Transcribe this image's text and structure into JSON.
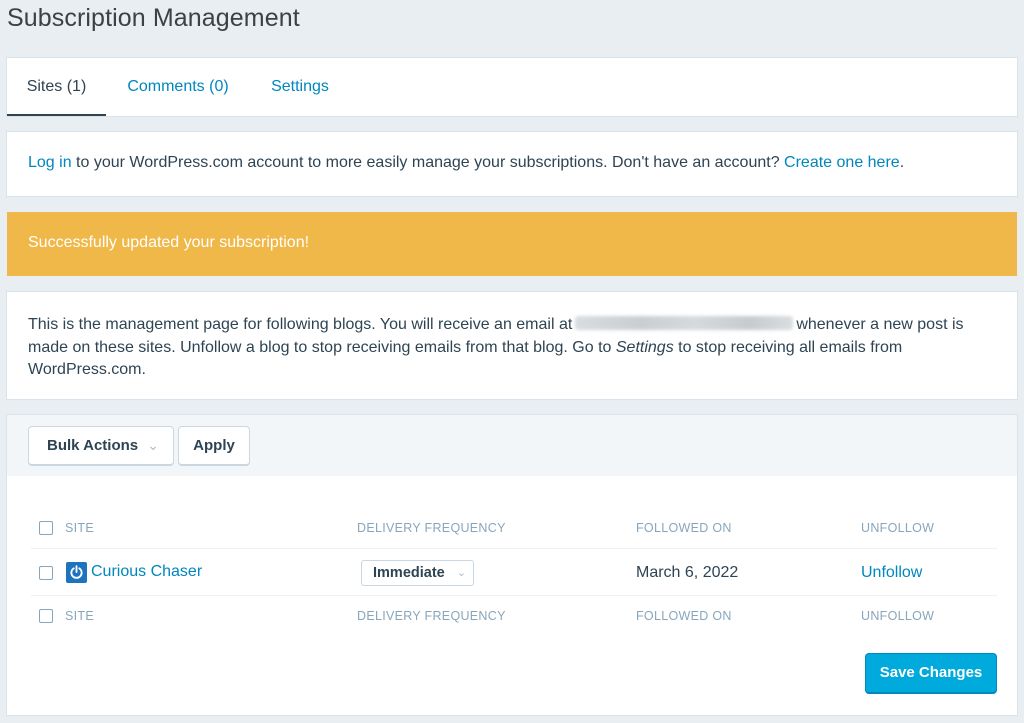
{
  "page": {
    "title": "Subscription Management"
  },
  "tabs": [
    {
      "label": "Sites (1)",
      "active": true
    },
    {
      "label": "Comments (0)",
      "active": false
    },
    {
      "label": "Settings",
      "active": false
    }
  ],
  "login_notice": {
    "login_link": "Log in",
    "text_middle": " to your WordPress.com account to more easily manage your subscriptions. Don't have an account? ",
    "create_link": "Create one here",
    "text_end": "."
  },
  "success_notice": {
    "text": "Successfully updated your subscription!"
  },
  "description": {
    "part1": "This is the management page for following blogs. You will receive an email at",
    "part2": "whenever a new post is made on these sites. Unfollow a blog to stop receiving emails from that blog. Go to",
    "settings_word": "Settings",
    "part3": "to stop receiving all emails from WordPress.com."
  },
  "toolbar": {
    "bulk_actions": "Bulk Actions",
    "apply": "Apply"
  },
  "table": {
    "columns": [
      "Site",
      "Delivery Frequency",
      "Followed On",
      "Unfollow"
    ],
    "rows": [
      {
        "site": "Curious Chaser",
        "frequency": "Immediate",
        "followed_on": "March 6, 2022",
        "action": "Unfollow"
      }
    ]
  },
  "save_button": "Save Changes",
  "colors": {
    "accent": "#0087be",
    "warning": "#f0b849",
    "primary_button": "#00aadc"
  },
  "icons": {
    "site": "power-icon",
    "dropdown": "chevron-down-icon"
  }
}
